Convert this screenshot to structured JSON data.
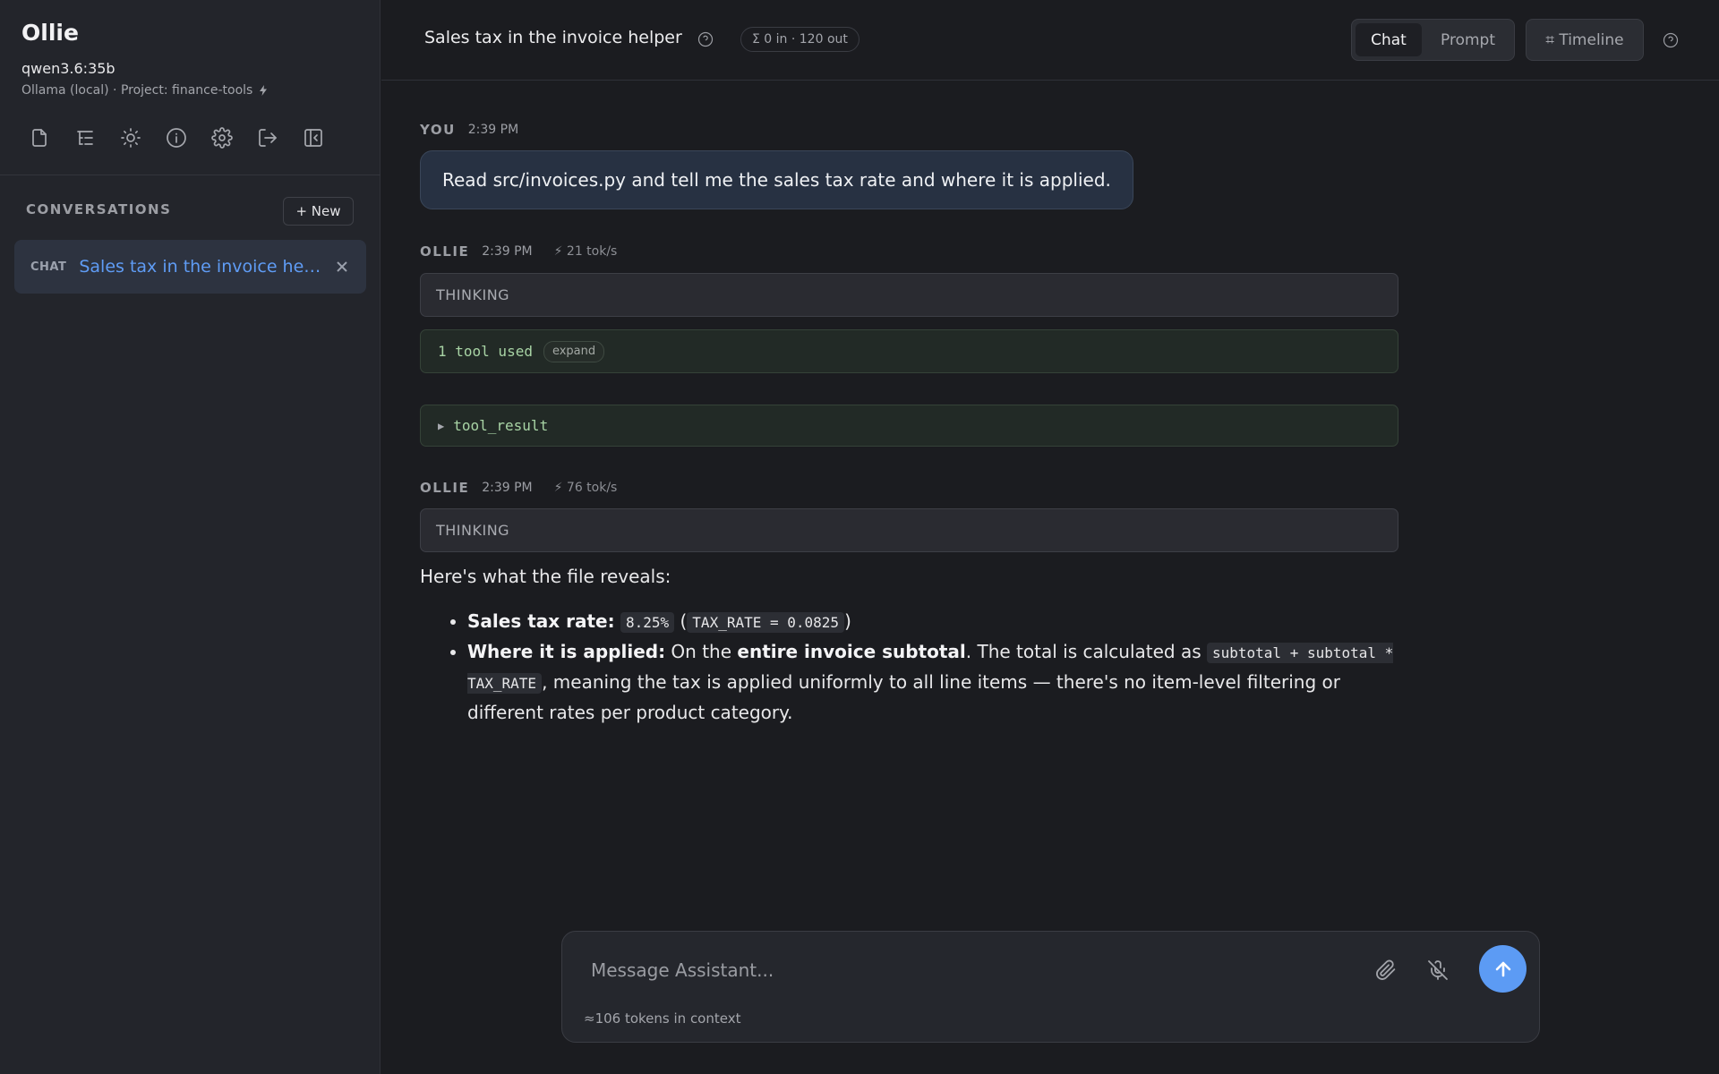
{
  "sidebar": {
    "app_title": "Ollie",
    "model": "qwen3.6:35b",
    "provider": "Ollama (local) · Project: finance-tools",
    "icons": [
      "file-icon",
      "tree-list-icon",
      "sun-icon",
      "info-icon",
      "gear-icon",
      "logout-icon",
      "collapse-sidebar-icon"
    ],
    "conversations_label": "CONVERSATIONS",
    "new_label": "+ New",
    "conversations": [
      {
        "tag": "CHAT",
        "title": "Sales tax in the invoice helper"
      }
    ]
  },
  "header": {
    "title": "Sales tax in the invoice helper",
    "tokens": "Σ 0 in · 120 out",
    "tabs": {
      "chat": "Chat",
      "prompt": "Prompt"
    },
    "active_tab": "Chat",
    "timeline": "⌗ Timeline"
  },
  "messages": {
    "user": {
      "author": "YOU",
      "time": "2:39 PM",
      "text": "Read src/invoices.py and tell me the sales tax rate and where it is applied."
    },
    "assistant1": {
      "author": "OLLIE",
      "time": "2:39 PM",
      "speed": "⚡ 21 tok/s",
      "thinking": "THINKING",
      "tools_used": "1 tool used",
      "expand": "expand",
      "tool_result": "tool_result"
    },
    "assistant2": {
      "author": "OLLIE",
      "time": "2:39 PM",
      "speed": "⚡ 76 tok/s",
      "thinking": "THINKING",
      "intro": "Here's what the file reveals:",
      "bullet1": {
        "label": "Sales tax rate:",
        "code1": "8.25%",
        "open_paren": "(",
        "code2": "TAX_RATE = 0.0825",
        "close_paren": ")"
      },
      "bullet2": {
        "label": "Where it is applied:",
        "text1": " On the ",
        "bold": "entire invoice subtotal",
        "text2": ". The total is calculated as ",
        "code": "subtotal + subtotal * TAX_RATE",
        "text3": ", meaning the tax is applied uniformly to all line items — there's no item-level filtering or different rates per product category."
      }
    }
  },
  "composer": {
    "placeholder": "Message Assistant...",
    "context_tokens": "≈106 tokens in context"
  }
}
